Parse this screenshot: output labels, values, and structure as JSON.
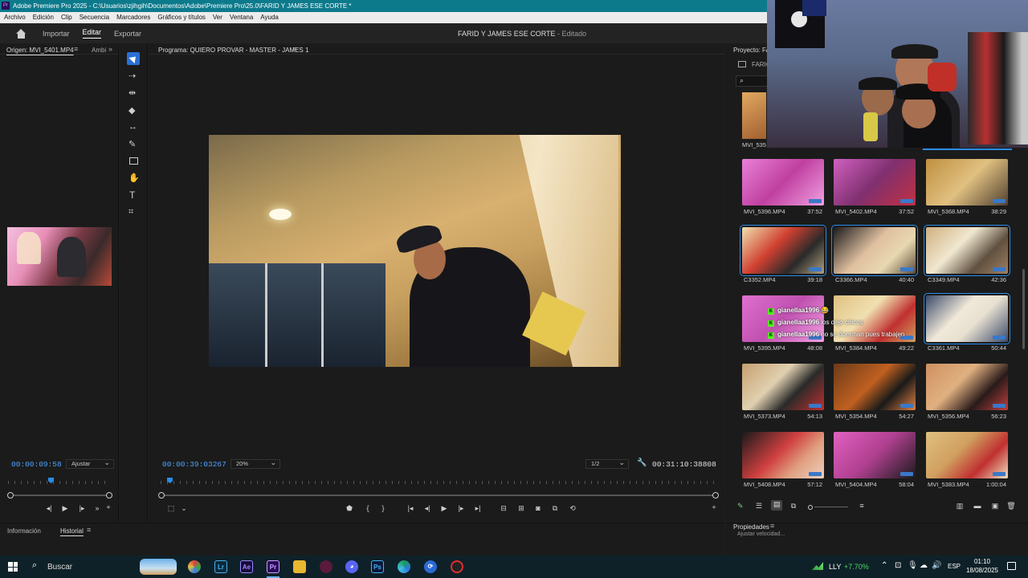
{
  "window": {
    "title": "Adobe Premiere Pro 2025 - C:\\Usuarios\\zjihgih\\Documentos\\Adobe\\Premiere Pro\\25.0\\FARID Y JAMES ESE CORTE *",
    "app_icon": "Pr"
  },
  "menu": [
    "Archivo",
    "Edición",
    "Clip",
    "Secuencia",
    "Marcadores",
    "Gráficos y títulos",
    "Ver",
    "Ventana",
    "Ayuda"
  ],
  "header": {
    "nav": [
      "Importar",
      "Editar",
      "Exportar"
    ],
    "active": "Editar",
    "project_name": "FARID Y JAMES ESE CORTE",
    "status": "- Editado"
  },
  "source": {
    "tab": "Origen: MVI_5401.MP4",
    "tab2": "Ambi",
    "timecode": "00:00:09:58",
    "fit": "Ajustar"
  },
  "program": {
    "title": "Programa: QUIERO PROVAR - MASTER - JAMES 1",
    "timecode": "00:00:39:03267",
    "zoom": "20%",
    "resolution": "1/2",
    "duration": "00:31:10:38808"
  },
  "bottom_left": {
    "tabs": [
      "Información",
      "Historial"
    ],
    "active": "Historial"
  },
  "project": {
    "tab": "Proyecto: FA",
    "folder": "FARIC",
    "partial_clip": "MVI_535",
    "clips": [
      {
        "name": "MVI_5396.MP4",
        "duration": "37:52",
        "selected": false
      },
      {
        "name": "MVI_5402.MP4",
        "duration": "37:52",
        "selected": false
      },
      {
        "name": "MVI_5368.MP4",
        "duration": "38:29",
        "selected": false
      },
      {
        "name": "C3352.MP4",
        "duration": "39:18",
        "selected": true
      },
      {
        "name": "C3366.MP4",
        "duration": "40:40",
        "selected": true
      },
      {
        "name": "C3349.MP4",
        "duration": "42:36",
        "selected": true
      },
      {
        "name": "MVI_5395.MP4",
        "duration": "48:08",
        "selected": false
      },
      {
        "name": "MVI_5384.MP4",
        "duration": "49:22",
        "selected": false
      },
      {
        "name": "C3361.MP4",
        "duration": "50:44",
        "selected": true
      },
      {
        "name": "MVI_5373.MP4",
        "duration": "54:13",
        "selected": false
      },
      {
        "name": "MVI_5354.MP4",
        "duration": "54:27",
        "selected": false
      },
      {
        "name": "MVI_5356.MP4",
        "duration": "56:23",
        "selected": false
      },
      {
        "name": "MVI_5408.MP4",
        "duration": "57:12",
        "selected": false
      },
      {
        "name": "MVI_5404.MP4",
        "duration": "58:04",
        "selected": false
      },
      {
        "name": "MVI_5383.MP4",
        "duration": "1:00:04",
        "selected": false
      }
    ]
  },
  "properties": {
    "tab": "Propiedades",
    "item": "Ajustar velocidad..."
  },
  "chat": [
    {
      "user": "gianellaa1996",
      "message": "😂"
    },
    {
      "user": "gianellaa1996",
      "message": "los dejo chicos"
    },
    {
      "user": "gianellaa1996",
      "message": "no se duerman pues trabajen"
    }
  ],
  "taskbar": {
    "search_placeholder": "Buscar",
    "apps": [
      "Lr",
      "Ae",
      "Pr",
      "Ps"
    ],
    "stock": {
      "symbol": "LLY",
      "change": "+7.70%"
    },
    "language": "ESP",
    "time": "01:10",
    "date": "18/08/2025"
  },
  "colors": {
    "accent": "#2a8ce6",
    "timecode": "#4ba3ff",
    "titlebar": "#0d7a8c",
    "stock_up": "#4cd964"
  }
}
